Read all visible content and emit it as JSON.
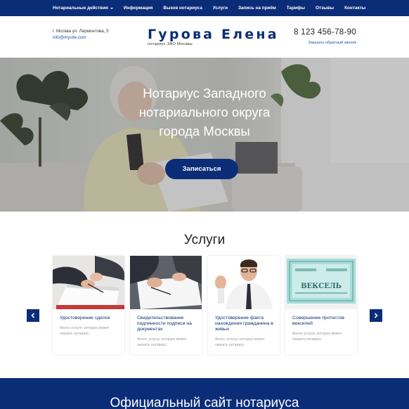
{
  "nav": {
    "items": [
      {
        "label": "Нотариальные действия",
        "has_dropdown": true
      },
      {
        "label": "Информация"
      },
      {
        "label": "Вызов нотариуса"
      },
      {
        "label": "Услуги"
      },
      {
        "label": "Запись на приём"
      },
      {
        "label": "Тарифы"
      },
      {
        "label": "Отзывы"
      },
      {
        "label": "Контакты"
      }
    ]
  },
  "header": {
    "address": "г. Москва ул. Лермонтова, 5",
    "email": "info@mysite.com",
    "brand_name": "Гурова Елена",
    "brand_subtitle": "нотариус ЗАО Москвы",
    "phone": "8 123 456-78-90",
    "callback_link": "Заказать обратный звонок"
  },
  "hero": {
    "title_lines": [
      "Нотариус Западного",
      "нотариального округа",
      "города Москвы"
    ],
    "button": "Записаться"
  },
  "services": {
    "heading": "Услуги",
    "cards": [
      {
        "title": "Удостоверение сделок",
        "description": "Анонс услуги, которую может оказать нотариус."
      },
      {
        "title": "Свидетельствование подлинности подписи на документах",
        "description": "Анонс услуги, которую может оказать нотариус."
      },
      {
        "title": "Удостоверение факта нахождения гражданина в живых",
        "description": "Анонс услуги, которую может оказать нотариус."
      },
      {
        "title": "Совершение протестов векселей",
        "description": "Анонс услуги, которую может оказать нотариус."
      }
    ],
    "bill_word": "ВЕКСЕЛЬ"
  },
  "banner": {
    "title": "Официальный сайт нотариуса"
  },
  "colors": {
    "primary": "#0b2d78",
    "link": "#1b4fb4"
  }
}
